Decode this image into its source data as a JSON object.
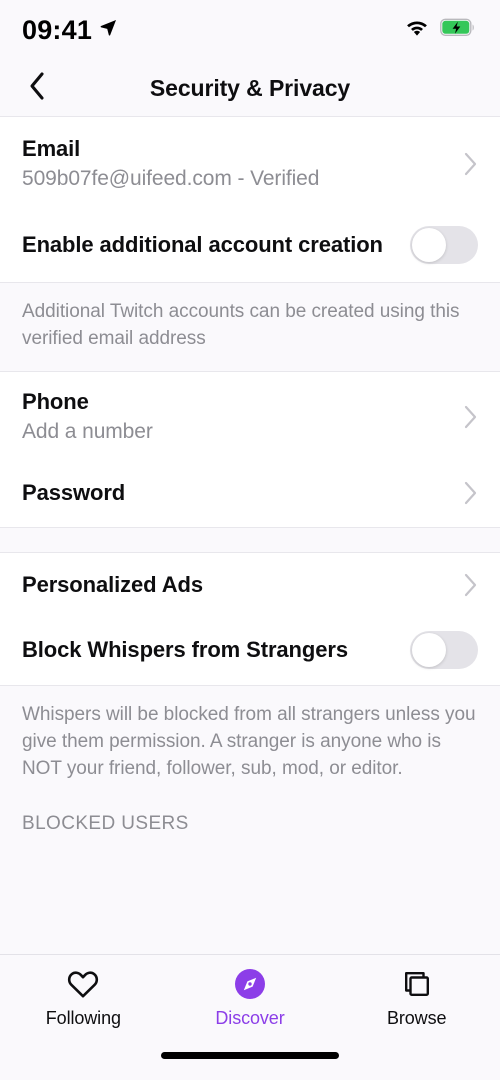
{
  "status_bar": {
    "time": "09:41",
    "location_icon": "location-arrow-icon",
    "wifi_icon": "wifi-icon",
    "battery_icon": "battery-charging-icon"
  },
  "header": {
    "back_icon": "chevron-left-icon",
    "title": "Security & Privacy"
  },
  "sections": {
    "account": {
      "email": {
        "title": "Email",
        "subtitle": "509b07fe@uifeed.com - Verified",
        "chevron_icon": "chevron-right-icon"
      },
      "additional_accounts": {
        "title": "Enable additional account creation",
        "toggle_state": "off"
      },
      "additional_accounts_note": "Additional Twitch accounts can be created using this verified email address",
      "phone": {
        "title": "Phone",
        "subtitle": "Add a number",
        "chevron_icon": "chevron-right-icon"
      },
      "password": {
        "title": "Password",
        "chevron_icon": "chevron-right-icon"
      }
    },
    "privacy": {
      "personalized_ads": {
        "title": "Personalized Ads",
        "chevron_icon": "chevron-right-icon"
      },
      "block_whispers": {
        "title": "Block Whispers from Strangers",
        "toggle_state": "off"
      },
      "block_whispers_note": "Whispers will be blocked from all strangers unless you give them permission. A stranger is anyone who is NOT your friend, follower, sub, mod, or editor.",
      "blocked_users_header": "BLOCKED USERS"
    }
  },
  "tab_bar": {
    "tabs": [
      {
        "label": "Following",
        "icon": "heart-icon",
        "active": false
      },
      {
        "label": "Discover",
        "icon": "compass-icon",
        "active": true
      },
      {
        "label": "Browse",
        "icon": "copy-stack-icon",
        "active": false
      }
    ]
  },
  "colors": {
    "accent": "#8c3ee8",
    "background": "#faf9fc",
    "surface": "#ffffff",
    "text_primary": "#0e0e10",
    "text_secondary": "#8d8d93",
    "divider": "#e8e7ec",
    "toggle_off_track": "#e4e3e8",
    "battery_green": "#34c759"
  }
}
